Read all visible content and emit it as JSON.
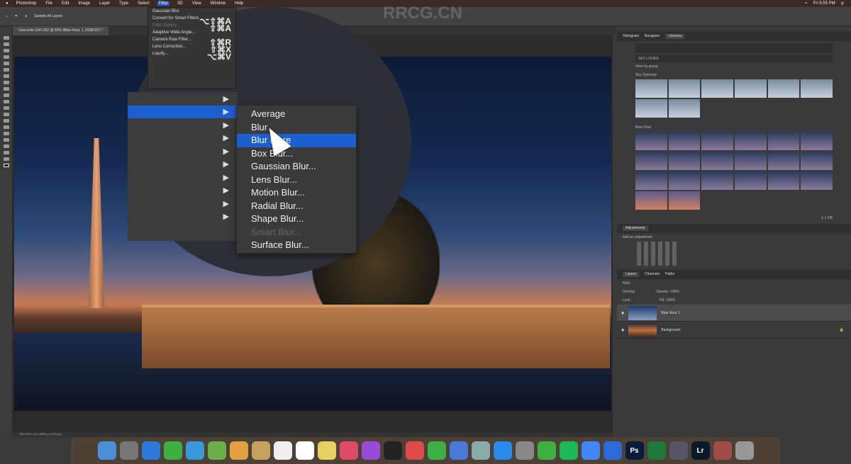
{
  "menubar": {
    "items": [
      "Photoshop",
      "File",
      "Edit",
      "Image",
      "Layer",
      "Type",
      "Select",
      "Filter",
      "3D",
      "View",
      "Window",
      "Help"
    ],
    "active": "Filter",
    "clock": "Fri 5:55 PM"
  },
  "options": {
    "sample": "Sample All Layers"
  },
  "document": {
    "tab": "Concorde-104.CR2 @ 50% (Blue Hour, 1, RGB/16*) *",
    "status": "50%    6977 px x 3948 px (300 ppi)"
  },
  "filter_menu": {
    "items": [
      {
        "label": "Gaussian Blur",
        "shortcut": ""
      },
      {
        "label": "Convert for Smart Filters",
        "shortcut": "⌥⇧⌘A"
      },
      {
        "label": "Filter Gallery...",
        "shortcut": ""
      },
      {
        "label": "Adaptive Wide Angle...",
        "shortcut": "⇧⌘A"
      },
      {
        "label": "Camera Raw Filter...",
        "shortcut": "⇧⌘R"
      },
      {
        "label": "Lens Correction...",
        "shortcut": "⇧⌘X"
      },
      {
        "label": "Liquify...",
        "shortcut": "⌥⌘V"
      }
    ]
  },
  "blur_submenu": {
    "items": [
      {
        "label": "Average",
        "state": "normal"
      },
      {
        "label": "Blur",
        "state": "normal"
      },
      {
        "label": "Blur More",
        "state": "highlighted"
      },
      {
        "label": "Box Blur...",
        "state": "normal"
      },
      {
        "label": "Gaussian Blur...",
        "state": "normal"
      },
      {
        "label": "Lens Blur...",
        "state": "normal"
      },
      {
        "label": "Motion Blur...",
        "state": "normal"
      },
      {
        "label": "Radial Blur...",
        "state": "normal"
      },
      {
        "label": "Shape Blur...",
        "state": "normal"
      },
      {
        "label": "Smart Blur...",
        "state": "disabled"
      },
      {
        "label": "Surface Blur...",
        "state": "normal"
      }
    ]
  },
  "right_panel": {
    "top_tabs": [
      "Histogram",
      "Navigator",
      "Libraries"
    ],
    "active_top_tab": "Libraries",
    "library": "SKY LOOKS",
    "filter_label": "View by group",
    "group1": "Sky Overcast",
    "group2": "Blue Hour",
    "size": "1.1 GB",
    "adjustments": {
      "title": "Adjustments",
      "subtitle": "Add an adjustment"
    },
    "layer_tabs": [
      "Layers",
      "Channels",
      "Paths"
    ],
    "kind": "Kind",
    "blend": "Overlay",
    "opacity_label": "Opacity:",
    "opacity": "100%",
    "lock_label": "Lock:",
    "fill_label": "Fill:",
    "fill": "100%",
    "layers": [
      {
        "name": "Blue Hour 1",
        "selected": true
      },
      {
        "name": "Background",
        "selected": false
      }
    ]
  },
  "dock": {
    "apps": [
      "Finder",
      "Launchpad",
      "Safari",
      "FaceTime",
      "Messages",
      "Maps",
      "Photos",
      "Notes",
      "Reminders",
      "Calendar",
      "Stickies",
      "Music",
      "Podcasts",
      "TV",
      "News",
      "Numbers",
      "Keynote",
      "Preview",
      "App Store",
      "System Preferences",
      "Evernote",
      "Spotify",
      "Chrome",
      "Edge",
      "Ps",
      "Excel",
      "Bridge",
      "Lr",
      "Photo Booth",
      "Trash"
    ]
  },
  "watermark": "RRCG.CN"
}
